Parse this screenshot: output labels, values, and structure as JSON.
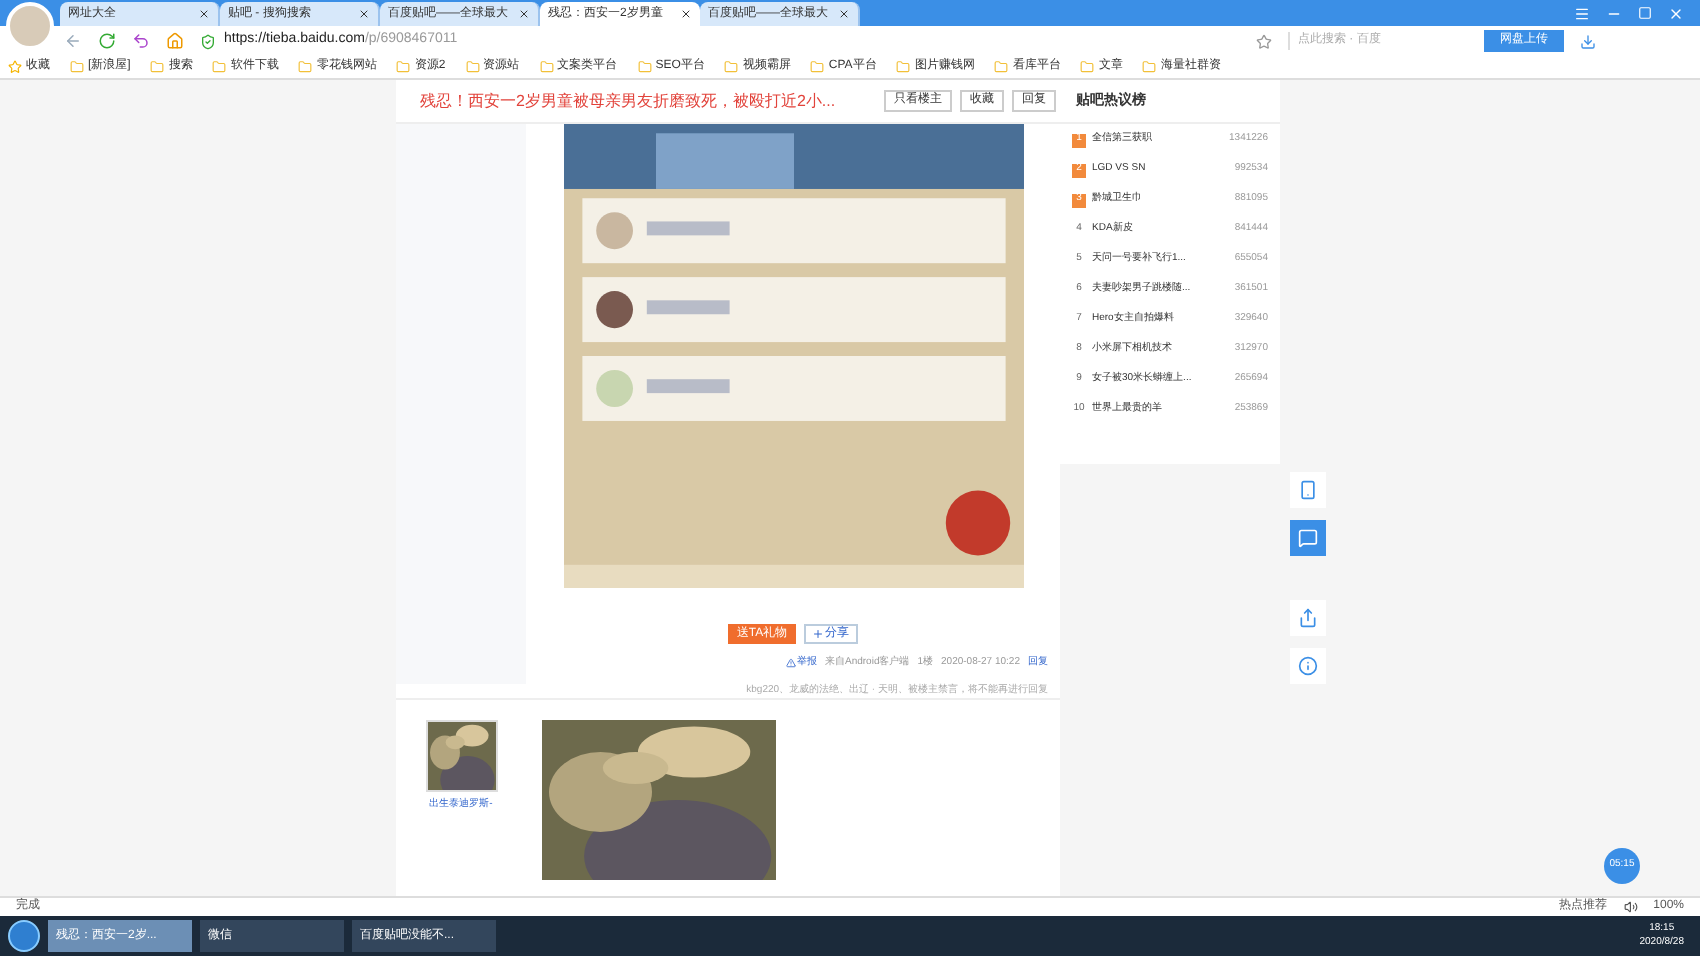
{
  "tabs": [
    {
      "label": "网址大全",
      "selected": false
    },
    {
      "label": "贴吧 - 搜狗搜索",
      "selected": false
    },
    {
      "label": "百度贴吧——全球最大",
      "selected": false
    },
    {
      "label": "残忍：西安一2岁男童",
      "selected": true
    },
    {
      "label": "百度贴吧——全球最大",
      "selected": false
    }
  ],
  "address": {
    "url_host": "https://tieba.baidu.com",
    "url_path": "/p/6908467011",
    "search_placeholder": "点此搜索 · 百度",
    "upload_button": "网盘上传"
  },
  "bookmarks": [
    "收藏",
    "[新浪屋]",
    "搜索",
    "软件下载",
    "零花钱网站",
    "资源2",
    "资源站",
    "文案类平台",
    "SEO平台",
    "视频霸屏",
    "CPA平台",
    "图片赚钱网",
    "看库平台",
    "文章",
    "海量社群资"
  ],
  "post": {
    "title": "残忍！西安一2岁男童被母亲男友折磨致死，被殴打近2小...",
    "actions": [
      "只看楼主",
      "收藏",
      "回复"
    ],
    "gift_button": "送TA礼物",
    "share_button": "分享",
    "meta": {
      "report": "举报",
      "source": "来自Android客户端",
      "floor": "1楼",
      "time": "2020-08-27 10:22",
      "reply": "回复"
    },
    "notice": "kbg220、龙威的法绝、出辽 · 天明、被楼主禁言，将不能再进行回复",
    "next_user": "出生泰迪罗斯-"
  },
  "hot_list": {
    "title": "贴吧热议榜",
    "items": [
      {
        "rank": "1",
        "name": "全信第三获职",
        "count": "1341226"
      },
      {
        "rank": "2",
        "name": "LGD VS SN",
        "count": "992534"
      },
      {
        "rank": "3",
        "name": "黔城卫生巾",
        "count": "881095"
      },
      {
        "rank": "4",
        "name": "KDA新皮",
        "count": "841444"
      },
      {
        "rank": "5",
        "name": "天问一号要补飞行1...",
        "count": "655054"
      },
      {
        "rank": "6",
        "name": "夫妻吵架男子跳楼随...",
        "count": "361501"
      },
      {
        "rank": "7",
        "name": "Hero女主自拍爆料",
        "count": "329640"
      },
      {
        "rank": "8",
        "name": "小米屏下相机技术",
        "count": "312970"
      },
      {
        "rank": "9",
        "name": "女子被30米长蟒缠上...",
        "count": "265694"
      },
      {
        "rank": "10",
        "name": "世界上最贵的羊",
        "count": "253869"
      }
    ]
  },
  "float_clock": "05:15",
  "status_bar": {
    "text": "完成",
    "hot": "热点推荐",
    "zoom": "100%"
  },
  "taskbar": {
    "items": [
      {
        "label": "残忍：西安一2岁...",
        "selected": true
      },
      {
        "label": "微信",
        "selected": false
      },
      {
        "label": "百度贴吧没能不...",
        "selected": false
      }
    ],
    "time": "18:15",
    "date": "2020/8/28"
  }
}
